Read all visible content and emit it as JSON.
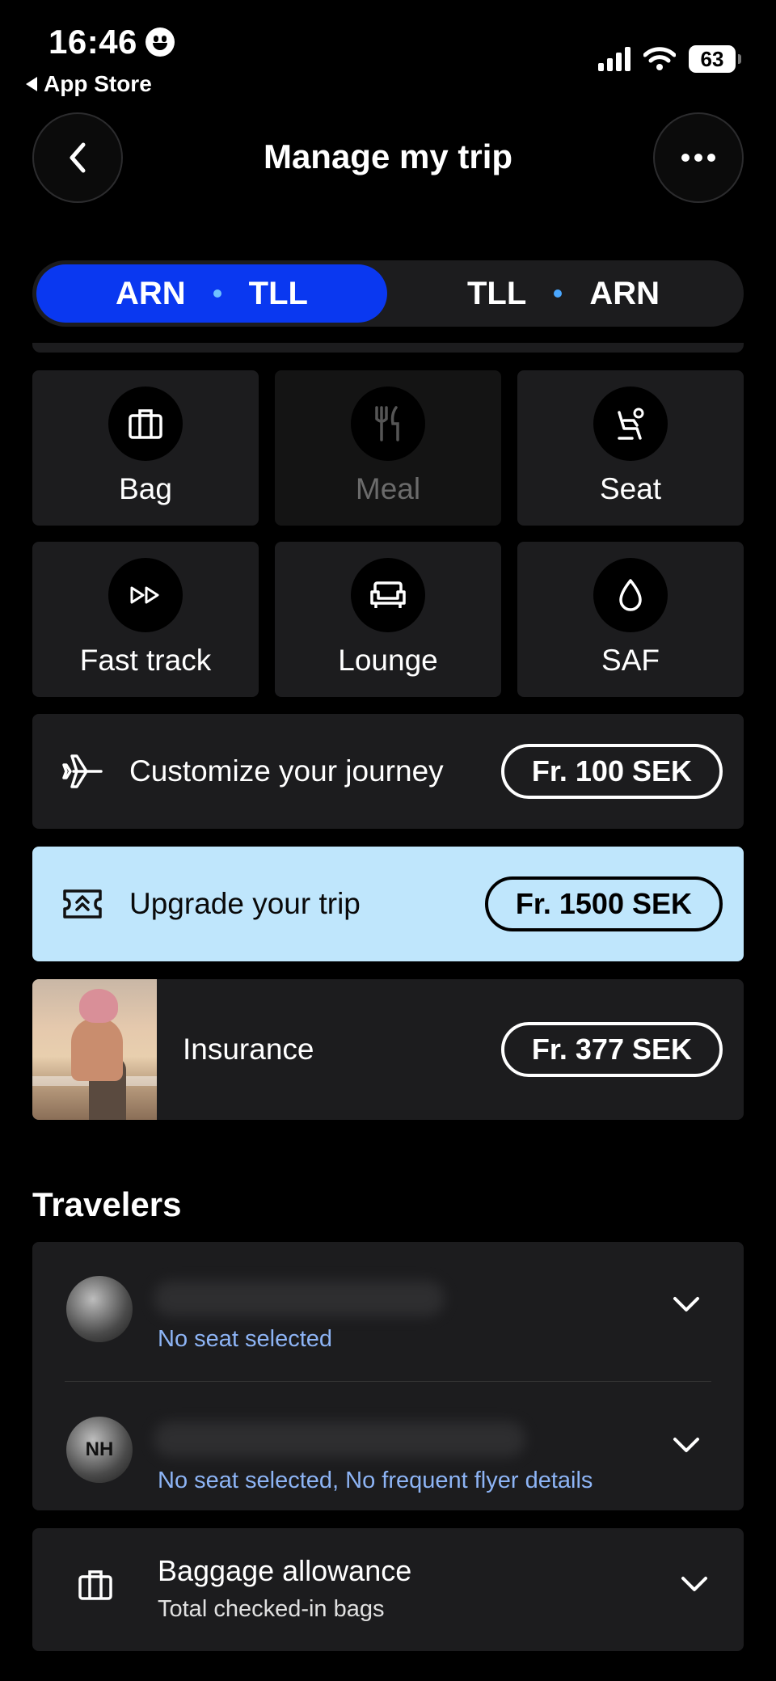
{
  "status_bar": {
    "time": "16:46",
    "back_app": "App Store",
    "battery": "63"
  },
  "nav": {
    "title": "Manage my trip"
  },
  "route_tabs": [
    {
      "from": "ARN",
      "to": "TLL",
      "active": true
    },
    {
      "from": "TLL",
      "to": "ARN",
      "active": false
    }
  ],
  "services": [
    {
      "label": "Bag",
      "icon": "suitcase-icon",
      "enabled": true
    },
    {
      "label": "Meal",
      "icon": "cutlery-icon",
      "enabled": false
    },
    {
      "label": "Seat",
      "icon": "seat-icon",
      "enabled": true
    },
    {
      "label": "Fast track",
      "icon": "fast-forward-icon",
      "enabled": true
    },
    {
      "label": "Lounge",
      "icon": "sofa-icon",
      "enabled": true
    },
    {
      "label": "SAF",
      "icon": "drop-icon",
      "enabled": true
    }
  ],
  "offers": {
    "customize": {
      "label": "Customize your journey",
      "price": "Fr. 100 SEK",
      "icon": "airplane-icon"
    },
    "upgrade": {
      "label": "Upgrade your trip",
      "price": "Fr. 1500 SEK",
      "icon": "upgrade-ticket-icon"
    },
    "insurance": {
      "label": "Insurance",
      "price": "Fr. 377 SEK"
    }
  },
  "travelers": {
    "title": "Travelers",
    "items": [
      {
        "status": "No seat selected"
      },
      {
        "initials": "NH",
        "status": "No seat selected, No frequent flyer details"
      }
    ]
  },
  "baggage": {
    "title": "Baggage allowance",
    "subtitle": "Total checked-in bags"
  },
  "colors": {
    "accent": "#0a38f0",
    "upgrade_bg": "#bfe6fc",
    "link_blue": "#8db4f5",
    "card_bg": "#1c1c1e"
  }
}
